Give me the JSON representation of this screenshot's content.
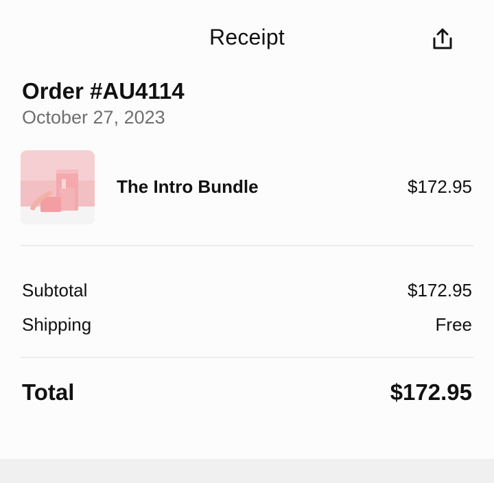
{
  "header": {
    "title": "Receipt",
    "share_icon": "share-icon"
  },
  "order": {
    "title": "Order #AU4114",
    "date": "October 27, 2023"
  },
  "items": [
    {
      "name": "The Intro Bundle",
      "price": "$172.95",
      "image": "product-photo"
    }
  ],
  "summary": {
    "subtotal_label": "Subtotal",
    "subtotal_value": "$172.95",
    "shipping_label": "Shipping",
    "shipping_value": "Free",
    "total_label": "Total",
    "total_value": "$172.95"
  },
  "colors": {
    "background": "#fcfcfc",
    "text": "#111111",
    "muted_text": "#6f6f6f",
    "divider": "#ececec",
    "product_pink": "#f2c1c4"
  }
}
